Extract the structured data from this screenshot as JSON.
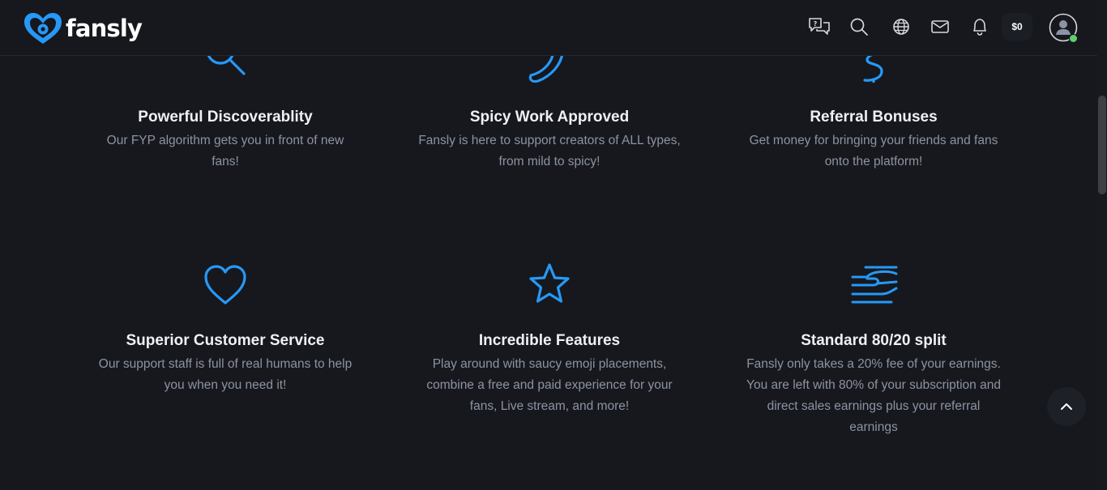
{
  "header": {
    "logo_text": "fansly",
    "balance": "$0",
    "icons": [
      "support-chat-icon",
      "search-icon",
      "globe-icon",
      "mail-icon",
      "bell-icon"
    ],
    "avatar_status": "online"
  },
  "features": [
    {
      "title": "Powerful Discoverablity",
      "icon": "search-icon",
      "lines": [
        "Our FYP algorithm gets you in front of new",
        "fans!"
      ]
    },
    {
      "title": "Spicy Work Approved",
      "icon": "chili-pepper-icon",
      "lines": [
        "Fansly is here to support creators of ALL types,",
        "from mild to spicy!"
      ]
    },
    {
      "title": "Referral Bonuses",
      "icon": "dollar-icon",
      "lines": [
        "Get money for bringing your friends and fans",
        "onto the platform!"
      ]
    },
    {
      "title": "Superior Customer Service",
      "icon": "heart-icon",
      "lines": [
        "Our support staff is full of real humans to help",
        "you when you need it!"
      ]
    },
    {
      "title": "Incredible Features",
      "icon": "star-icon",
      "lines": [
        "Play around with saucy emoji placements,",
        "combine a free and paid experience for your",
        "fans, Live stream, and more!"
      ]
    },
    {
      "title": "Standard 80/20 split",
      "icon": "hand-money-icon",
      "lines": [
        "Fansly only takes a 20% fee of your earnings.",
        "You are left with 80% of your subscription and",
        "direct sales earnings plus your referral",
        "earnings"
      ]
    }
  ],
  "colors": {
    "background": "#16181d",
    "accent": "#2699f7",
    "title": "#eef0f5",
    "description": "#8c93a3",
    "online": "#5fce6f"
  }
}
